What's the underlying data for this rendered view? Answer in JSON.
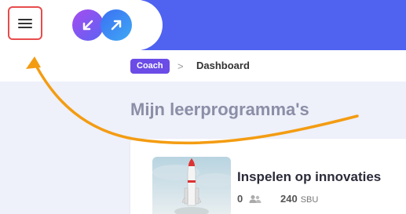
{
  "header": {
    "menu_icon": "hamburger-menu-icon",
    "logo_icon": "infinity-arrows-logo",
    "accent_color": "#4f63f0",
    "highlight_color": "#e74c4c"
  },
  "breadcrumb": {
    "badge_label": "Coach",
    "separator": ">",
    "current": "Dashboard",
    "badge_color": "#6b4ce6"
  },
  "main": {
    "title": "Mijn leerprogramma's",
    "courses": [
      {
        "title": "Inspelen op innovaties",
        "participants": "0",
        "participants_icon": "people-icon",
        "sbu_value": "240",
        "sbu_unit": "SBU",
        "thumbnail": "rocket-launch-image"
      }
    ]
  },
  "annotation": {
    "arrow_color": "#f39c12",
    "arrow_icon": "curved-arrow-pointing-to-menu"
  }
}
